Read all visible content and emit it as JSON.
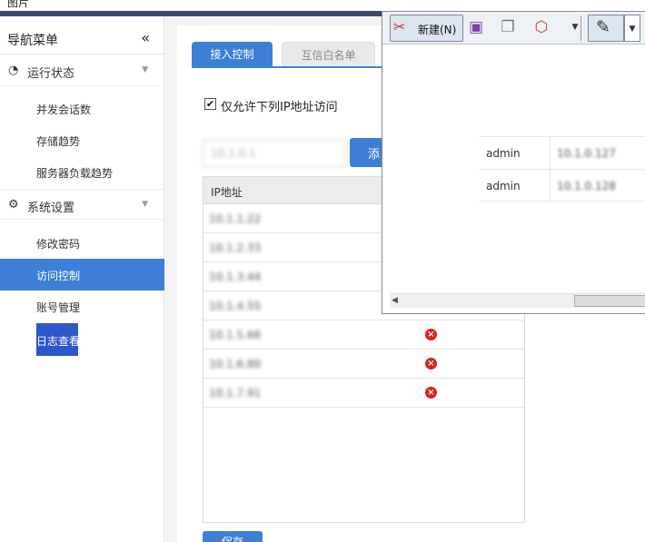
{
  "window": {
    "title": "图片"
  },
  "sidebar": {
    "title": "导航菜单",
    "collapse_icon": "«",
    "groups": [
      {
        "label": "运行状态",
        "icon": "gauge-icon"
      },
      {
        "label": "系统设置",
        "icon": "gear-icon"
      }
    ],
    "items": [
      {
        "label": "并发会话数"
      },
      {
        "label": "存储趋势"
      },
      {
        "label": "服务器负载趋势"
      },
      {
        "label": "修改密码"
      },
      {
        "label": "访问控制",
        "active": true
      },
      {
        "label": "账号管理"
      },
      {
        "label": "日志查看"
      }
    ]
  },
  "main": {
    "tabs": [
      {
        "label": "接入控制",
        "active": true
      },
      {
        "label": "互信白名单",
        "active": false
      }
    ],
    "checkbox": {
      "label": "仅允许下列IP地址访问",
      "checked": true
    },
    "ip_input": {
      "value": "10.1.0.1"
    },
    "add_button": "添",
    "table": {
      "header": "IP地址",
      "rows": [
        {
          "ip": "10.1.1.22"
        },
        {
          "ip": "10.1.2.33"
        },
        {
          "ip": "10.1.3.44"
        },
        {
          "ip": "10.1.4.55"
        },
        {
          "ip": "10.1.5.66"
        },
        {
          "ip": "10.1.6.80"
        },
        {
          "ip": "10.1.7.91"
        }
      ]
    },
    "save_button": "保存"
  },
  "overlay": {
    "toolbar": {
      "new_label": "新建(N)"
    },
    "users": [
      {
        "name": "admin",
        "value": "10.1.0.127"
      },
      {
        "name": "admin",
        "value": "10.1.0.128"
      }
    ]
  },
  "colors": {
    "accent": "#3d7fd6",
    "active_item": "#2c57c9",
    "delete": "#e0201c"
  }
}
